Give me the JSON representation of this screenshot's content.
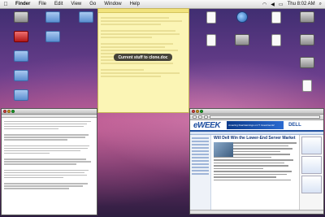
{
  "menubar": {
    "apple": "",
    "items": [
      "Finder",
      "File",
      "Edit",
      "View",
      "Go",
      "Window",
      "Help"
    ],
    "clock": "Thu 8:02 AM"
  },
  "tooltip": "Current stuff to clone.doc",
  "browser": {
    "logo": "eWEEK",
    "advertiser": "DELL",
    "ad_text": "Amazing Dual Earnings on IT Investments!",
    "headline": "Will Dell Win the Lower-End Server Market"
  }
}
